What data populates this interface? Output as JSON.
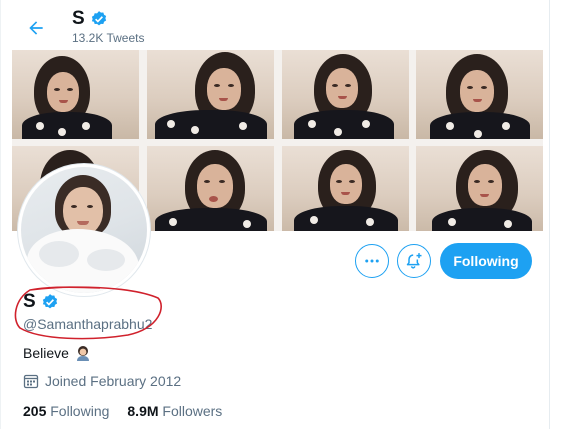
{
  "header": {
    "name": "S",
    "tweet_count": "13.2K Tweets"
  },
  "profile": {
    "name": "S",
    "handle": "@Samanthaprabhu2",
    "bio": "Believe",
    "joined": "Joined February 2012",
    "following_count": "205",
    "following_label": "Following",
    "followers_count": "8.9M",
    "followers_label": "Followers"
  },
  "actions": {
    "following_button": "Following"
  },
  "icons": {
    "back": "arrow-left-icon",
    "verified": "verified-badge-icon",
    "more": "more-dots-icon",
    "notify": "bell-plus-icon",
    "calendar": "calendar-icon",
    "bio_emoji": "woman-emoji-icon"
  },
  "colors": {
    "accent": "#1da1f2",
    "secondary_text": "#5b7083",
    "annotation": "#d0212c"
  }
}
